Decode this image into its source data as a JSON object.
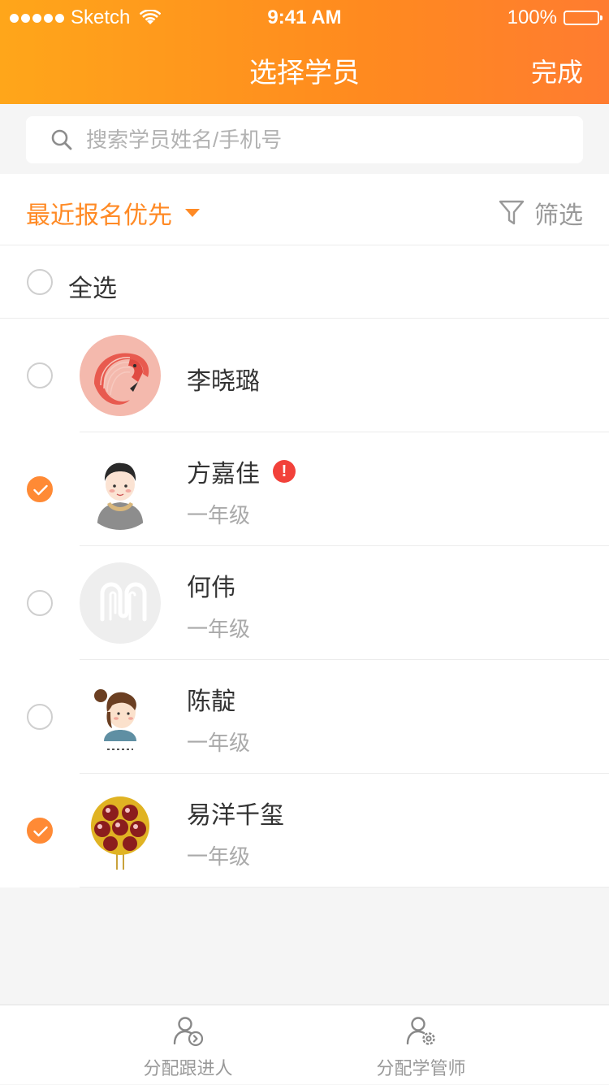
{
  "status_bar": {
    "carrier": "Sketch",
    "time": "9:41 AM",
    "battery": "100%"
  },
  "header": {
    "title": "选择学员",
    "done_label": "完成"
  },
  "search": {
    "placeholder": "搜索学员姓名/手机号"
  },
  "sort_bar": {
    "sort_label": "最近报名优先",
    "filter_label": "筛选"
  },
  "select_all": {
    "label": "全选",
    "checked": false
  },
  "students": [
    {
      "name": "李晓璐",
      "grade": "",
      "checked": false,
      "warning": false,
      "avatar": "flamingo-avatar"
    },
    {
      "name": "方嘉佳",
      "grade": "一年级",
      "checked": true,
      "warning": true,
      "warning_mark": "!",
      "avatar": "boy-avatar"
    },
    {
      "name": "何伟",
      "grade": "一年级",
      "checked": false,
      "warning": false,
      "avatar": "placeholder-avatar"
    },
    {
      "name": "陈靛",
      "grade": "一年级",
      "checked": false,
      "warning": false,
      "avatar": "girl-avatar"
    },
    {
      "name": "易洋千玺",
      "grade": "一年级",
      "checked": true,
      "warning": false,
      "avatar": "candy-avatar"
    }
  ],
  "tabbar": {
    "tab1_label": "分配跟进人",
    "tab2_label": "分配学管师"
  },
  "colors": {
    "accent": "#ff8a25",
    "header_start": "#ffa61a",
    "header_end": "#ff7c30",
    "warning": "#f2413a"
  }
}
